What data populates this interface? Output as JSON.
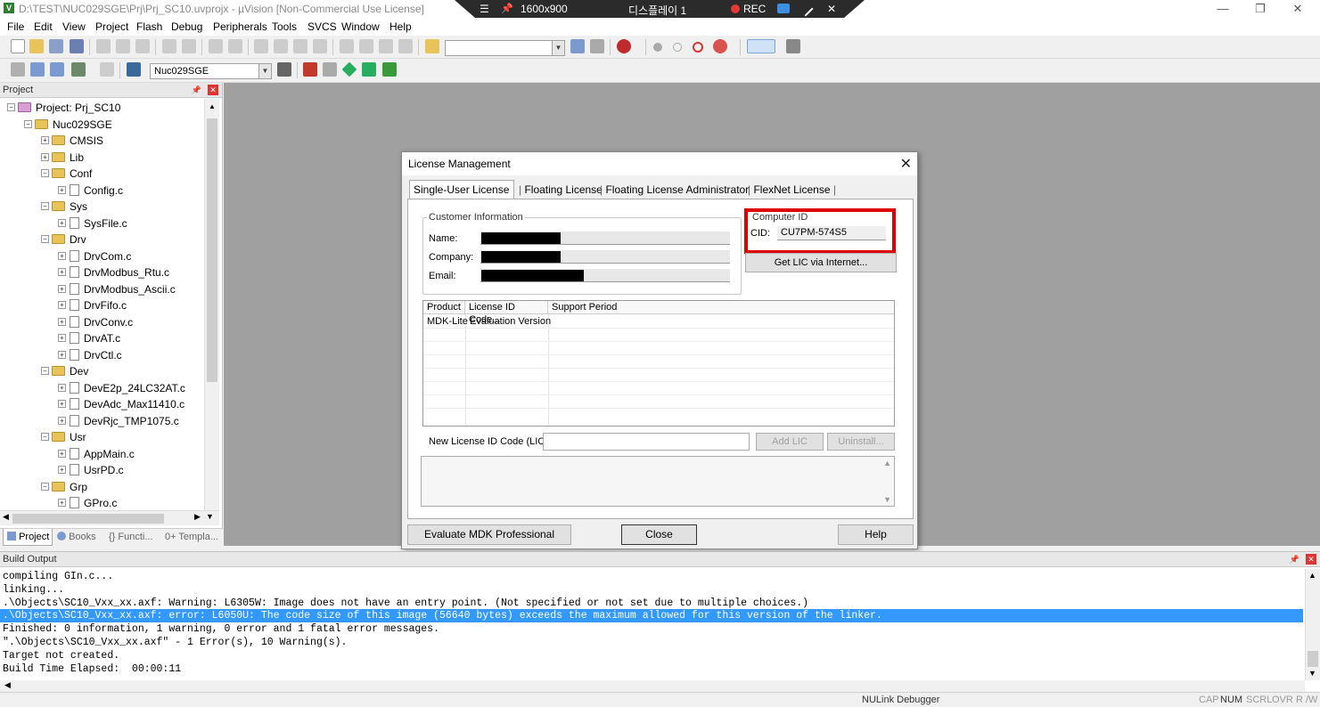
{
  "titlebar": {
    "icon": "V",
    "text": "D:\\TEST\\NUC029SGE\\Prj\\Prj_SC10.uvprojx - µVision  [Non-Commercial Use License]",
    "min_glyph": "—",
    "max_glyph": "❐",
    "close_glyph": "✕"
  },
  "recording_bar": {
    "menu_icon": "☰",
    "pin_icon": "📌",
    "resolution": "1600x900",
    "display": "디스플레이 1",
    "rec_label": "REC",
    "rec_color": "#e53935",
    "close": "✕"
  },
  "menubar": [
    "File",
    "Edit",
    "View",
    "Project",
    "Flash",
    "Debug",
    "Peripherals",
    "Tools",
    "SVCS",
    "Window",
    "Help"
  ],
  "toolbar2": {
    "target": "Nuc029SGE"
  },
  "project_panel": {
    "title": "Project",
    "pin": "📌",
    "close": "✕",
    "tree": [
      {
        "label": "Project: Prj_SC10",
        "depth": 0,
        "type": "root",
        "exp": "−"
      },
      {
        "label": "Nuc029SGE",
        "depth": 1,
        "type": "folder",
        "exp": "−"
      },
      {
        "label": "CMSIS",
        "depth": 2,
        "type": "folder",
        "exp": "+"
      },
      {
        "label": "Lib",
        "depth": 2,
        "type": "folder",
        "exp": "+"
      },
      {
        "label": "Conf",
        "depth": 2,
        "type": "folder",
        "exp": "−"
      },
      {
        "label": "Config.c",
        "depth": 3,
        "type": "file",
        "exp": "+"
      },
      {
        "label": "Sys",
        "depth": 2,
        "type": "folder",
        "exp": "−"
      },
      {
        "label": "SysFile.c",
        "depth": 3,
        "type": "file",
        "exp": "+"
      },
      {
        "label": "Drv",
        "depth": 2,
        "type": "folder",
        "exp": "−"
      },
      {
        "label": "DrvCom.c",
        "depth": 3,
        "type": "file",
        "exp": "+"
      },
      {
        "label": "DrvModbus_Rtu.c",
        "depth": 3,
        "type": "file",
        "exp": "+"
      },
      {
        "label": "DrvModbus_Ascii.c",
        "depth": 3,
        "type": "file",
        "exp": "+"
      },
      {
        "label": "DrvFifo.c",
        "depth": 3,
        "type": "file",
        "exp": "+"
      },
      {
        "label": "DrvConv.c",
        "depth": 3,
        "type": "file",
        "exp": "+"
      },
      {
        "label": "DrvAT.c",
        "depth": 3,
        "type": "file",
        "exp": "+"
      },
      {
        "label": "DrvCtl.c",
        "depth": 3,
        "type": "file",
        "exp": "+"
      },
      {
        "label": "Dev",
        "depth": 2,
        "type": "folder",
        "exp": "−"
      },
      {
        "label": "DevE2p_24LC32AT.c",
        "depth": 3,
        "type": "file",
        "exp": "+"
      },
      {
        "label": "DevAdc_Max11410.c",
        "depth": 3,
        "type": "file",
        "exp": "+"
      },
      {
        "label": "DevRjc_TMP1075.c",
        "depth": 3,
        "type": "file",
        "exp": "+"
      },
      {
        "label": "Usr",
        "depth": 2,
        "type": "folder",
        "exp": "−"
      },
      {
        "label": "AppMain.c",
        "depth": 3,
        "type": "file",
        "exp": "+"
      },
      {
        "label": "UsrPD.c",
        "depth": 3,
        "type": "file",
        "exp": "+"
      },
      {
        "label": "Grp",
        "depth": 2,
        "type": "folder",
        "exp": "−"
      },
      {
        "label": "GPro.c",
        "depth": 3,
        "type": "file",
        "exp": "+"
      }
    ],
    "tabs": [
      "Project",
      "Books",
      "{} Functi...",
      "0+ Templa..."
    ]
  },
  "dialog": {
    "title": "License Management",
    "close": "✕",
    "tabs": [
      "Single-User License",
      "Floating License",
      "Floating License Administrator",
      "FlexNet License"
    ],
    "customer_info": {
      "legend": "Customer Information",
      "name_label": "Name:",
      "company_label": "Company:",
      "email_label": "Email:"
    },
    "computer_id": {
      "legend": "Computer ID",
      "cid_label": "CID:",
      "cid_value": "CU7PM-574S5",
      "get_lic_button": "Get LIC via Internet..."
    },
    "license_table": {
      "columns": [
        "Product",
        "License ID Code...",
        "Support Period"
      ],
      "rows": [
        [
          "MDK-Lite",
          "Evaluation Version",
          ""
        ]
      ]
    },
    "new_lic_label": "New License ID Code (LIC):",
    "new_lic_value": "",
    "add_lic_button": "Add LIC",
    "uninstall_button": "Uninstall...",
    "evaluate_button": "Evaluate MDK Professional",
    "close_button": "Close",
    "help_button": "Help"
  },
  "build_output": {
    "title": "Build Output",
    "lines": [
      "compiling GIn.c...",
      "linking...",
      ".\\Objects\\SC10_Vxx_xx.axf: Warning: L6305W: Image does not have an entry point. (Not specified or not set due to multiple choices.)",
      ".\\Objects\\SC10_Vxx_xx.axf: error: L6050U: The code size of this image (56640 bytes) exceeds the maximum allowed for this version of the linker.",
      "Finished: 0 information, 1 warning, 0 error and 1 fatal error messages.",
      "\".\\Objects\\SC10_Vxx_xx.axf\" - 1 Error(s), 10 Warning(s).",
      "Target not created.",
      "Build Time Elapsed:  00:00:11"
    ],
    "highlighted_index": 3
  },
  "statusbar": {
    "debugger": "NULink Debugger",
    "indicators": [
      "CAP",
      "NUM",
      "SCRL",
      "OVR",
      "R /W"
    ]
  }
}
